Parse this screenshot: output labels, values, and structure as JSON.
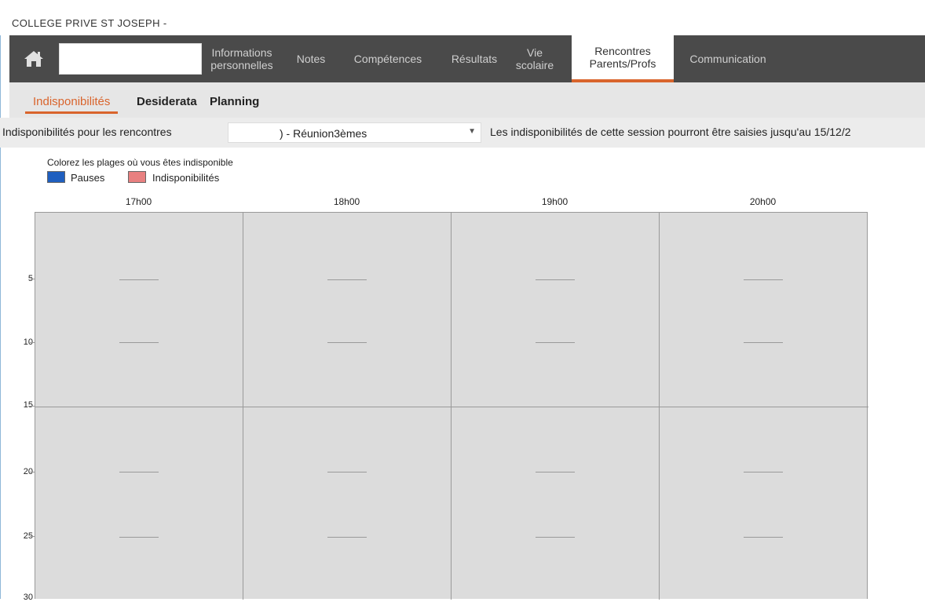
{
  "window": {
    "title": "COLLEGE PRIVE ST JOSEPH -"
  },
  "nav": {
    "home_icon": "home-icon",
    "items": [
      {
        "label": "Informations\npersonnelles",
        "active": false
      },
      {
        "label": "Notes",
        "active": false
      },
      {
        "label": "Compétences",
        "active": false
      },
      {
        "label": "Résultats",
        "active": false
      },
      {
        "label": "Vie\nscolaire",
        "active": false
      },
      {
        "label": "Rencontres\nParents/Profs",
        "active": true
      },
      {
        "label": "Communication",
        "active": false
      }
    ]
  },
  "subtabs": [
    {
      "label": "Indisponibilités",
      "active": true
    },
    {
      "label": "Desiderata",
      "active": false
    },
    {
      "label": "Planning",
      "active": false
    }
  ],
  "filter": {
    "label": "Indisponibilités pour les rencontres",
    "session_value": ") - Réunion3èmes",
    "deadline": "Les indisponibilités de cette session pourront être saisies jusqu'au 15/12/2"
  },
  "legend": {
    "instruction": "Colorez les plages où vous êtes indisponible",
    "items": [
      {
        "label": "Pauses",
        "color": "#1f5fbf"
      },
      {
        "label": "Indisponibilités",
        "color": "#e88080"
      }
    ]
  },
  "grid": {
    "columns": [
      "17h00",
      "18h00",
      "19h00",
      "20h00"
    ],
    "row_labels": [
      "5",
      "10",
      "15",
      "20",
      "25",
      "30"
    ],
    "cell_color": "#dcdcdc"
  },
  "colors": {
    "accent": "#d9642c",
    "navbar": "#4a4a4a"
  }
}
